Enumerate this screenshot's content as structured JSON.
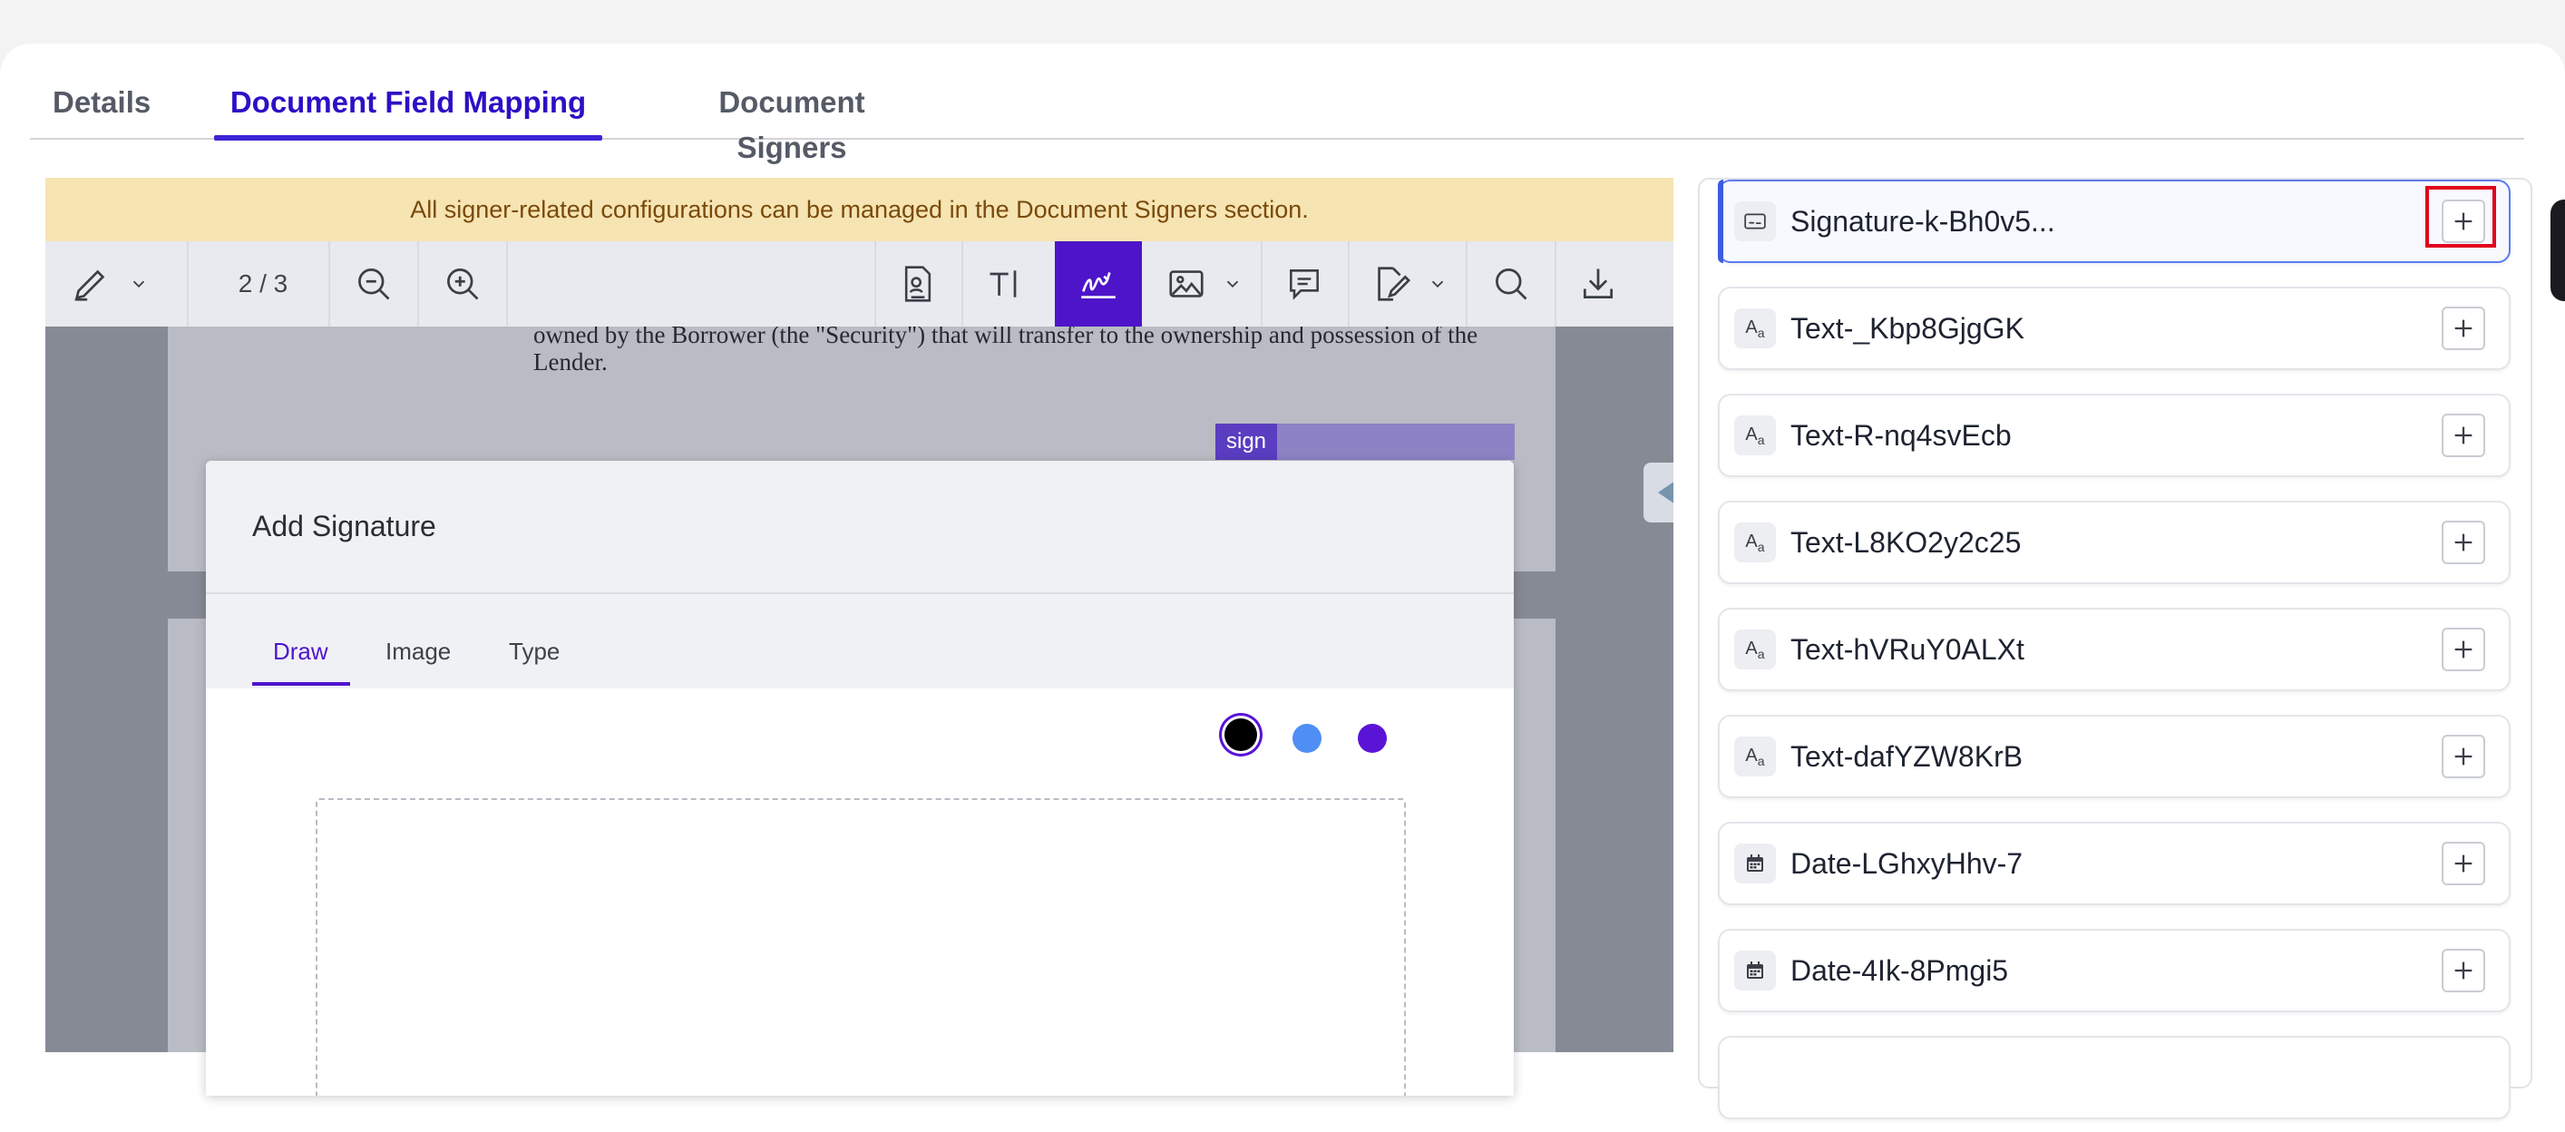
{
  "tabs": [
    {
      "label": "Details",
      "active": false
    },
    {
      "label": "Document Field Mapping",
      "active": true
    },
    {
      "label": "Document Signers",
      "active": false
    }
  ],
  "banner": {
    "text": "All signer-related configurations can be managed in the Document Signers section."
  },
  "toolbar": {
    "page_indicator": "2 / 3",
    "icons": [
      "pen-icon",
      "chevron-down-icon",
      "zoom-out-icon",
      "zoom-in-icon",
      "document-icon",
      "text-tool-icon",
      "signature-icon",
      "image-icon",
      "chevron-down-icon",
      "comment-icon",
      "edit-document-icon",
      "chevron-down-icon",
      "search-icon",
      "download-icon"
    ],
    "active_tool": "signature-icon",
    "active_color": "#4d14c9"
  },
  "document": {
    "line1": "owned by the Borrower (the \"Security\") that will transfer to the ownership and possession of the",
    "line2": "Lender.",
    "sign_tag": "sign"
  },
  "modal": {
    "title": "Add Signature",
    "tabs": [
      {
        "label": "Draw",
        "active": true
      },
      {
        "label": "Image",
        "active": false
      },
      {
        "label": "Type",
        "active": false
      }
    ],
    "pen_colors": [
      "#000000",
      "#4f8ef5",
      "#5a14d6"
    ],
    "selected_color": "#000000"
  },
  "fields": [
    {
      "label": "Signature-k-Bh0v5...",
      "icon": "signature-field-icon",
      "selected": true
    },
    {
      "label": "Text-_Kbp8GjgGK",
      "icon": "text-field-icon"
    },
    {
      "label": "Text-R-nq4svEcb",
      "icon": "text-field-icon"
    },
    {
      "label": "Text-L8KO2y2c25",
      "icon": "text-field-icon"
    },
    {
      "label": "Text-hVRuY0ALXt",
      "icon": "text-field-icon"
    },
    {
      "label": "Text-dafYZW8KrB",
      "icon": "text-field-icon"
    },
    {
      "label": "Date-LGhxyHhv-7",
      "icon": "calendar-icon"
    },
    {
      "label": "Date-4Ik-8Pmgi5",
      "icon": "calendar-icon"
    }
  ],
  "highlight_color": "#e0001b"
}
